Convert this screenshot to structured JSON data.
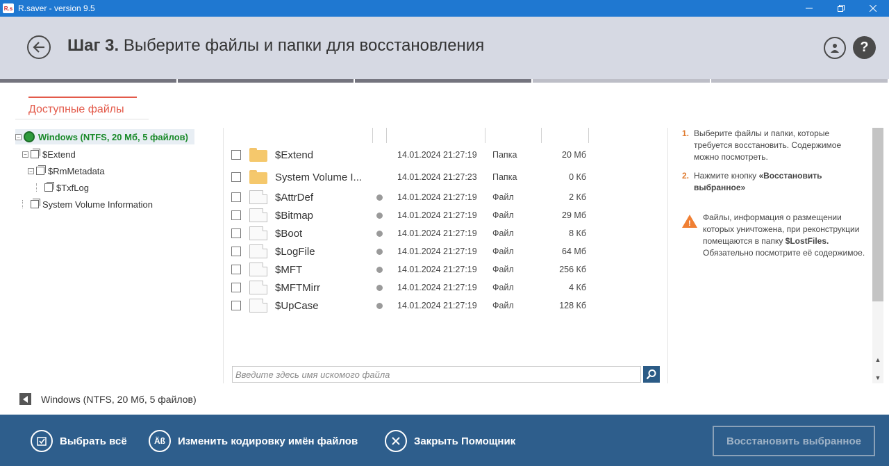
{
  "window": {
    "logo_text": "R.s",
    "title": "R.saver - version 9.5"
  },
  "header": {
    "step_label": "Шаг 3.",
    "step_title": "Выберите файлы и папки для восстановления"
  },
  "tabs": [
    {
      "label": "Доступные файлы"
    }
  ],
  "tree": {
    "items": [
      {
        "label": "Windows (NTFS, 20 Мб, 5 файлов)"
      },
      {
        "label": "$Extend"
      },
      {
        "label": "$RmMetadata"
      },
      {
        "label": "$TxfLog"
      },
      {
        "label": "System Volume Information"
      }
    ]
  },
  "files": [
    {
      "name": "$Extend",
      "date": "14.01.2024 21:27:19",
      "type": "Папка",
      "size": "20 Мб",
      "kind": "folder"
    },
    {
      "name": "System Volume I...",
      "date": "14.01.2024 21:27:23",
      "type": "Папка",
      "size": "0 Кб",
      "kind": "folder"
    },
    {
      "name": "$AttrDef",
      "date": "14.01.2024 21:27:19",
      "type": "Файл",
      "size": "2 Кб",
      "kind": "file"
    },
    {
      "name": "$Bitmap",
      "date": "14.01.2024 21:27:19",
      "type": "Файл",
      "size": "29 Мб",
      "kind": "file"
    },
    {
      "name": "$Boot",
      "date": "14.01.2024 21:27:19",
      "type": "Файл",
      "size": "8 Кб",
      "kind": "file"
    },
    {
      "name": "$LogFile",
      "date": "14.01.2024 21:27:19",
      "type": "Файл",
      "size": "64 Мб",
      "kind": "file"
    },
    {
      "name": "$MFT",
      "date": "14.01.2024 21:27:19",
      "type": "Файл",
      "size": "256 Кб",
      "kind": "file"
    },
    {
      "name": "$MFTMirr",
      "date": "14.01.2024 21:27:19",
      "type": "Файл",
      "size": "4 Кб",
      "kind": "file"
    },
    {
      "name": "$UpCase",
      "date": "14.01.2024 21:27:19",
      "type": "Файл",
      "size": "128 Кб",
      "kind": "file"
    }
  ],
  "search": {
    "placeholder": "Введите здесь имя искомого файла"
  },
  "info": {
    "step1_num": "1.",
    "step1_text": "Выберите файлы и папки, которые требуется восстановить. Содержимое можно посмотреть.",
    "step2_num": "2.",
    "step2_prefix": "Нажмите кнопку ",
    "step2_bold": "«Восстановить выбранное»",
    "warn_prefix": "Файлы, информация о размещении которых уничтожена, при реконструкции помещаются в папку ",
    "warn_bold": "$LostFiles.",
    "warn_suffix": " Обязательно посмотрите её содержимое."
  },
  "status": {
    "text": "Windows (NTFS, 20 Мб, 5 файлов)"
  },
  "footer": {
    "select_all": "Выбрать всё",
    "encoding_icon": "Äß",
    "change_encoding": "Изменить кодировку имён файлов",
    "close_wizard": "Закрыть Помощник",
    "restore": "Восстановить выбранное"
  },
  "colors": {
    "titlebar": "#1f78d1",
    "header_bg": "#d6d9e3",
    "accent_tab": "#e35a4a",
    "tree_selected_text": "#1a8a2a",
    "footer_bg": "#2e5e8c",
    "info_number": "#e07b2f",
    "warning": "#f07f33"
  },
  "icons": [
    "back-arrow-icon",
    "user-icon",
    "help-icon",
    "folder-icon",
    "file-icon",
    "search-icon",
    "warning-icon",
    "select-all-icon",
    "encoding-icon",
    "close-icon"
  ]
}
